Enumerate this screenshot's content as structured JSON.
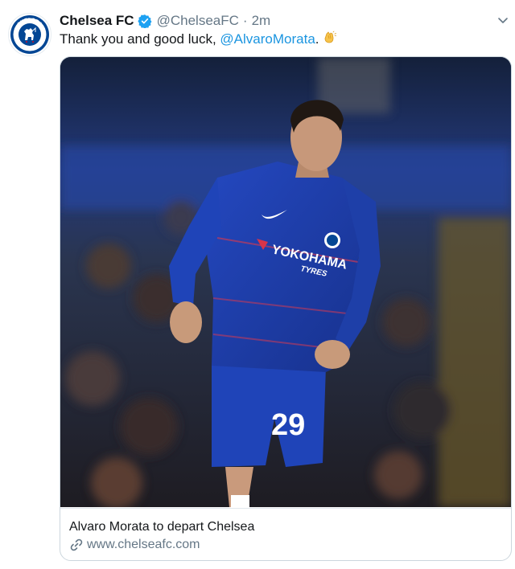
{
  "tweet": {
    "author_name": "Chelsea FC",
    "handle": "@ChelseaFC",
    "separator": "·",
    "time": "2m",
    "text_prefix": "Thank you and good luck, ",
    "mention": "@AlvaroMorata",
    "text_suffix": ".",
    "emoji": "clapping-hands",
    "avatar_text_top": "CHELSEA",
    "avatar_text_bottom": "FOOTBALL CLUB"
  },
  "card": {
    "title": "Alvaro Morata to depart Chelsea",
    "domain": "www.chelseafc.com",
    "photo": {
      "sponsor": "YOKOHAMA",
      "sponsor_sub": "TYRES",
      "shirt_number": "29"
    }
  },
  "colors": {
    "text": "#14171a",
    "secondary": "#657786",
    "link": "#1b95e0",
    "verified": "#1da1f2",
    "kit_blue": "#1b3fa6",
    "club_navy": "#034694"
  }
}
